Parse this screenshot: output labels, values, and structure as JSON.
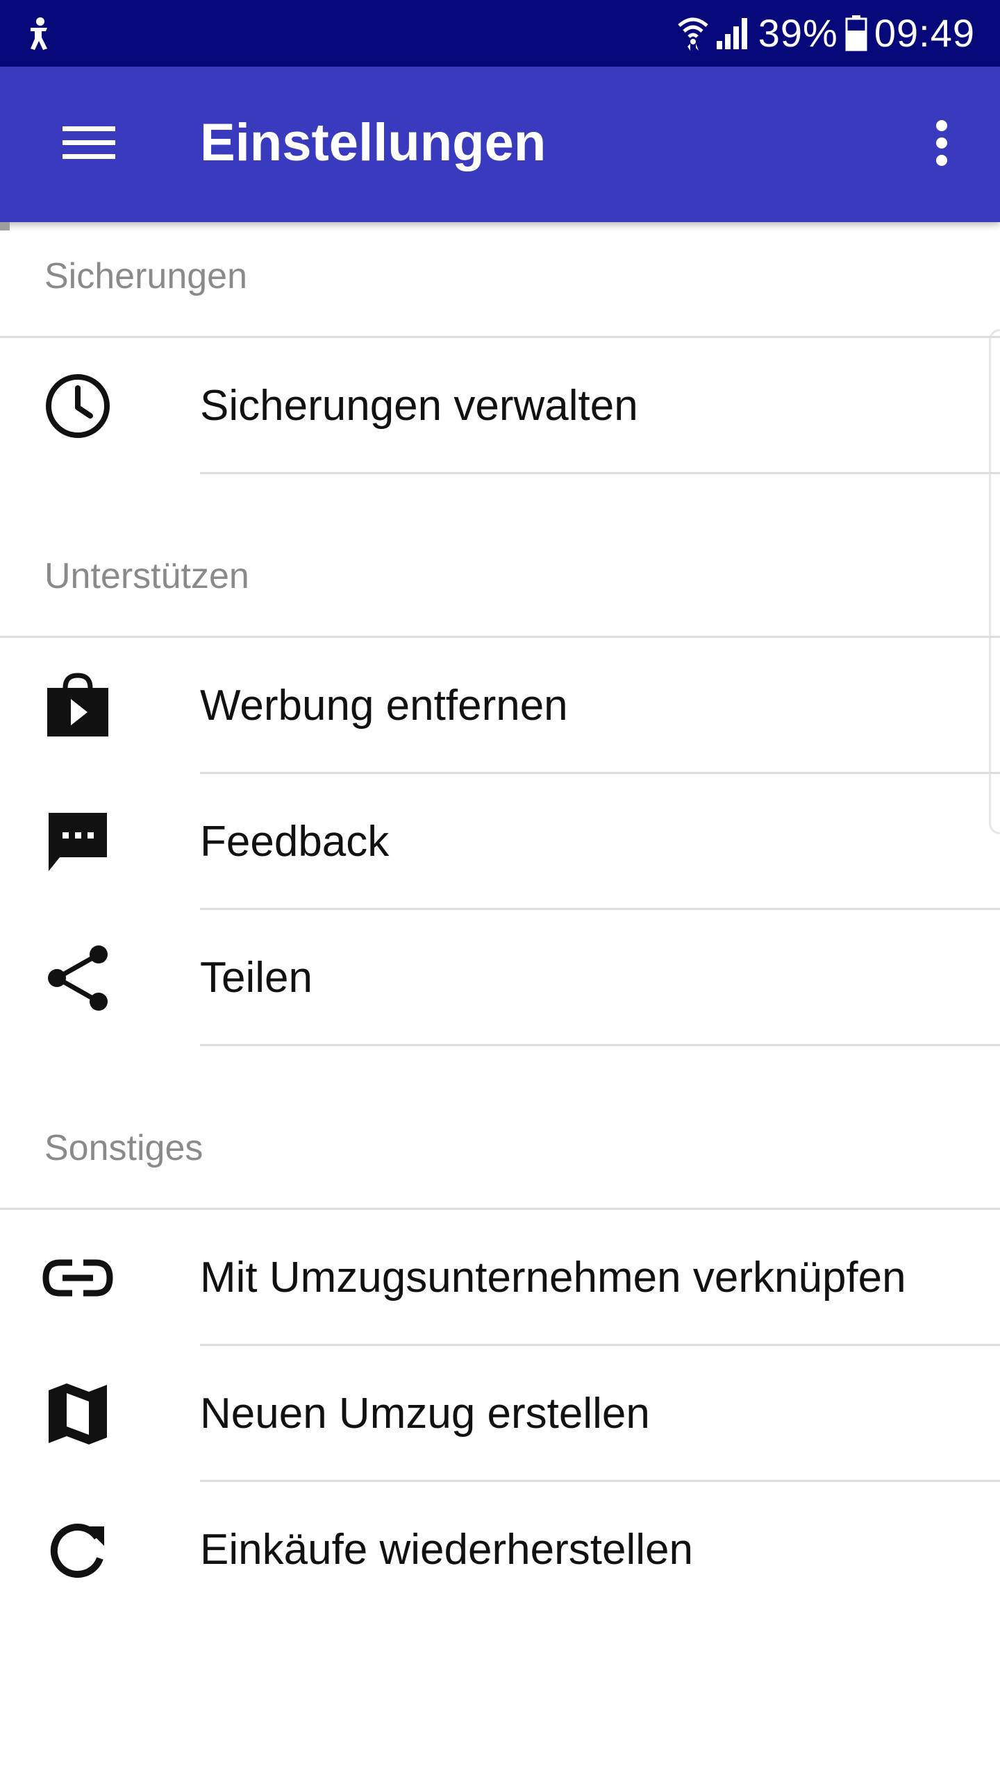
{
  "status_bar": {
    "battery": "39%",
    "time": "09:49",
    "icons": [
      "accessibility-icon",
      "wifi-icon",
      "signal-icon",
      "battery-icon"
    ]
  },
  "app_bar": {
    "title": "Einstellungen",
    "menu_icon": "menu-icon",
    "overflow_icon": "more-vert-icon",
    "background": "#3a3abf"
  },
  "sections": [
    {
      "label": "Sicherungen",
      "items": [
        {
          "label": "Sicherungen verwalten",
          "icon": "clock-icon"
        }
      ]
    },
    {
      "label": "Unterstützen",
      "items": [
        {
          "label": "Werbung entfernen",
          "icon": "shopping-bag-play-icon"
        },
        {
          "label": "Feedback",
          "icon": "feedback-icon"
        },
        {
          "label": "Teilen",
          "icon": "share-icon"
        }
      ]
    },
    {
      "label": "Sonstiges",
      "items": [
        {
          "label": "Mit Umzugsunternehmen verknüpfen",
          "icon": "link-icon"
        },
        {
          "label": "Neuen Umzug erstellen",
          "icon": "map-icon"
        },
        {
          "label": "Einkäufe wiederherstellen",
          "icon": "refresh-icon"
        }
      ]
    }
  ],
  "colors": {
    "status_bar": "#06087a",
    "section_label": "#8a8a8a",
    "divider": "#dddddd"
  }
}
